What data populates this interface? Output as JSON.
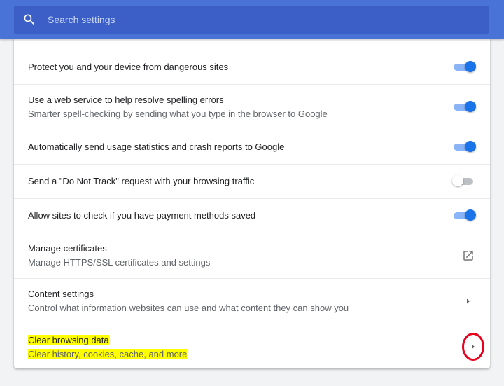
{
  "search": {
    "placeholder": "Search settings"
  },
  "rows": [
    {
      "primary": "Protect you and your device from dangerous sites",
      "toggle": "on"
    },
    {
      "primary": "Use a web service to help resolve spelling errors",
      "secondary": "Smarter spell-checking by sending what you type in the browser to Google",
      "toggle": "on"
    },
    {
      "primary": "Automatically send usage statistics and crash reports to Google",
      "toggle": "on"
    },
    {
      "primary": "Send a \"Do Not Track\" request with your browsing traffic",
      "toggle": "off"
    },
    {
      "primary": "Allow sites to check if you have payment methods saved",
      "toggle": "on"
    },
    {
      "primary": "Manage certificates",
      "secondary": "Manage HTTPS/SSL certificates and settings",
      "icon": "open-in-new-icon"
    },
    {
      "primary": "Content settings",
      "secondary": "Control what information websites can use and what content they can show you",
      "icon": "arrow-right-icon"
    },
    {
      "primary": "Clear browsing data",
      "secondary": "Clear history, cookies, cache, and more",
      "icon": "arrow-right-icon",
      "highlighted": true
    }
  ],
  "colors": {
    "topbar": "#4a73d8",
    "toggle_on": "#1a73e8",
    "highlight": "#ffff00",
    "annotation": "#e8001c"
  }
}
